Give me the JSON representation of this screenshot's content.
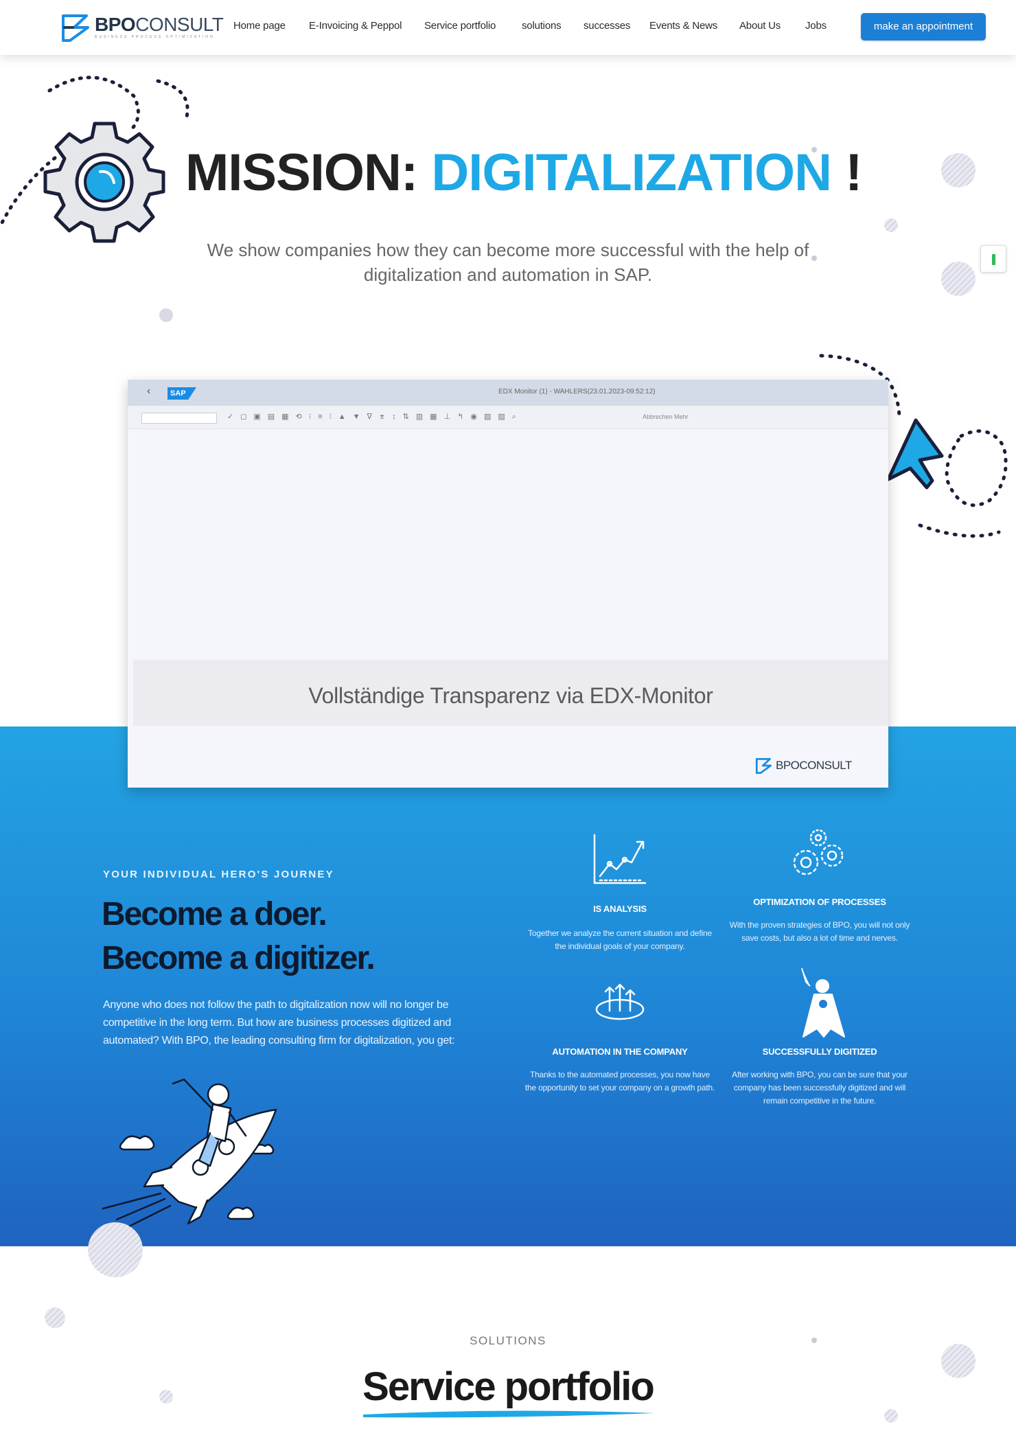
{
  "header": {
    "logo_bold": "BPO",
    "logo_light": "CONSULT",
    "logo_tagline": "BUSINESS PROCESS OPTIMIZATION",
    "nav": [
      "Home page",
      "E-Invoicing & Peppol",
      "Service portfolio",
      "solutions",
      "successes",
      "Events & News",
      "About Us",
      "Jobs"
    ],
    "cta_label": "make an appointment"
  },
  "hero": {
    "title_dark": "MISSION:",
    "title_blue": "DIGITALIZATION",
    "title_end": "!",
    "subtitle": "We show companies how they can become more successful with the help of digitalization and automation in SAP."
  },
  "screenshot": {
    "sap_label": "SAP",
    "window_title": "EDX Monitor (1) - WAHLERS(23.01.2023-09:52:12)",
    "toolbar_extra": "Abbrechen   Mehr",
    "caption": "Vollständige Transparenz via EDX-Monitor",
    "logo_word": "BPOCONSULT"
  },
  "journey": {
    "eyebrow": "YOUR INDIVIDUAL HERO'S JOURNEY",
    "heading_line1": "Become a doer.",
    "heading_line2": "Become a digitizer.",
    "intro": "Anyone who does not follow the path to digitalization now will no longer be competitive in the long term. But how are business processes digitized and automated? With BPO, the leading consulting firm for digitalization, you get:",
    "features": [
      {
        "title": "IS ANALYSIS",
        "text": "Together we analyze the current situation and define the individual goals of your company.",
        "icon": "chart-growth-icon"
      },
      {
        "title": "OPTIMIZATION OF PROCESSES",
        "text": "With the proven strategies of BPO, you will not only save costs, but also a lot of time and nerves.",
        "icon": "gears-icon"
      },
      {
        "title": "AUTOMATION IN THE COMPANY",
        "text": "Thanks to the automated processes, you now have the opportunity to set your company on a growth path.",
        "icon": "arrows-up-icon"
      },
      {
        "title": "SUCCESSFULLY DIGITIZED",
        "text": "After working with BPO, you can be sure that your company has been successfully digitized and will remain competitive in the future.",
        "icon": "superhero-icon"
      }
    ]
  },
  "solutions": {
    "eyebrow": "SOLUTIONS",
    "title": "Service portfolio"
  },
  "colors": {
    "accent": "#1ea8e6",
    "cta": "#1c7fd6",
    "section_top": "#23a3e3",
    "section_bottom": "#1f63bf"
  }
}
